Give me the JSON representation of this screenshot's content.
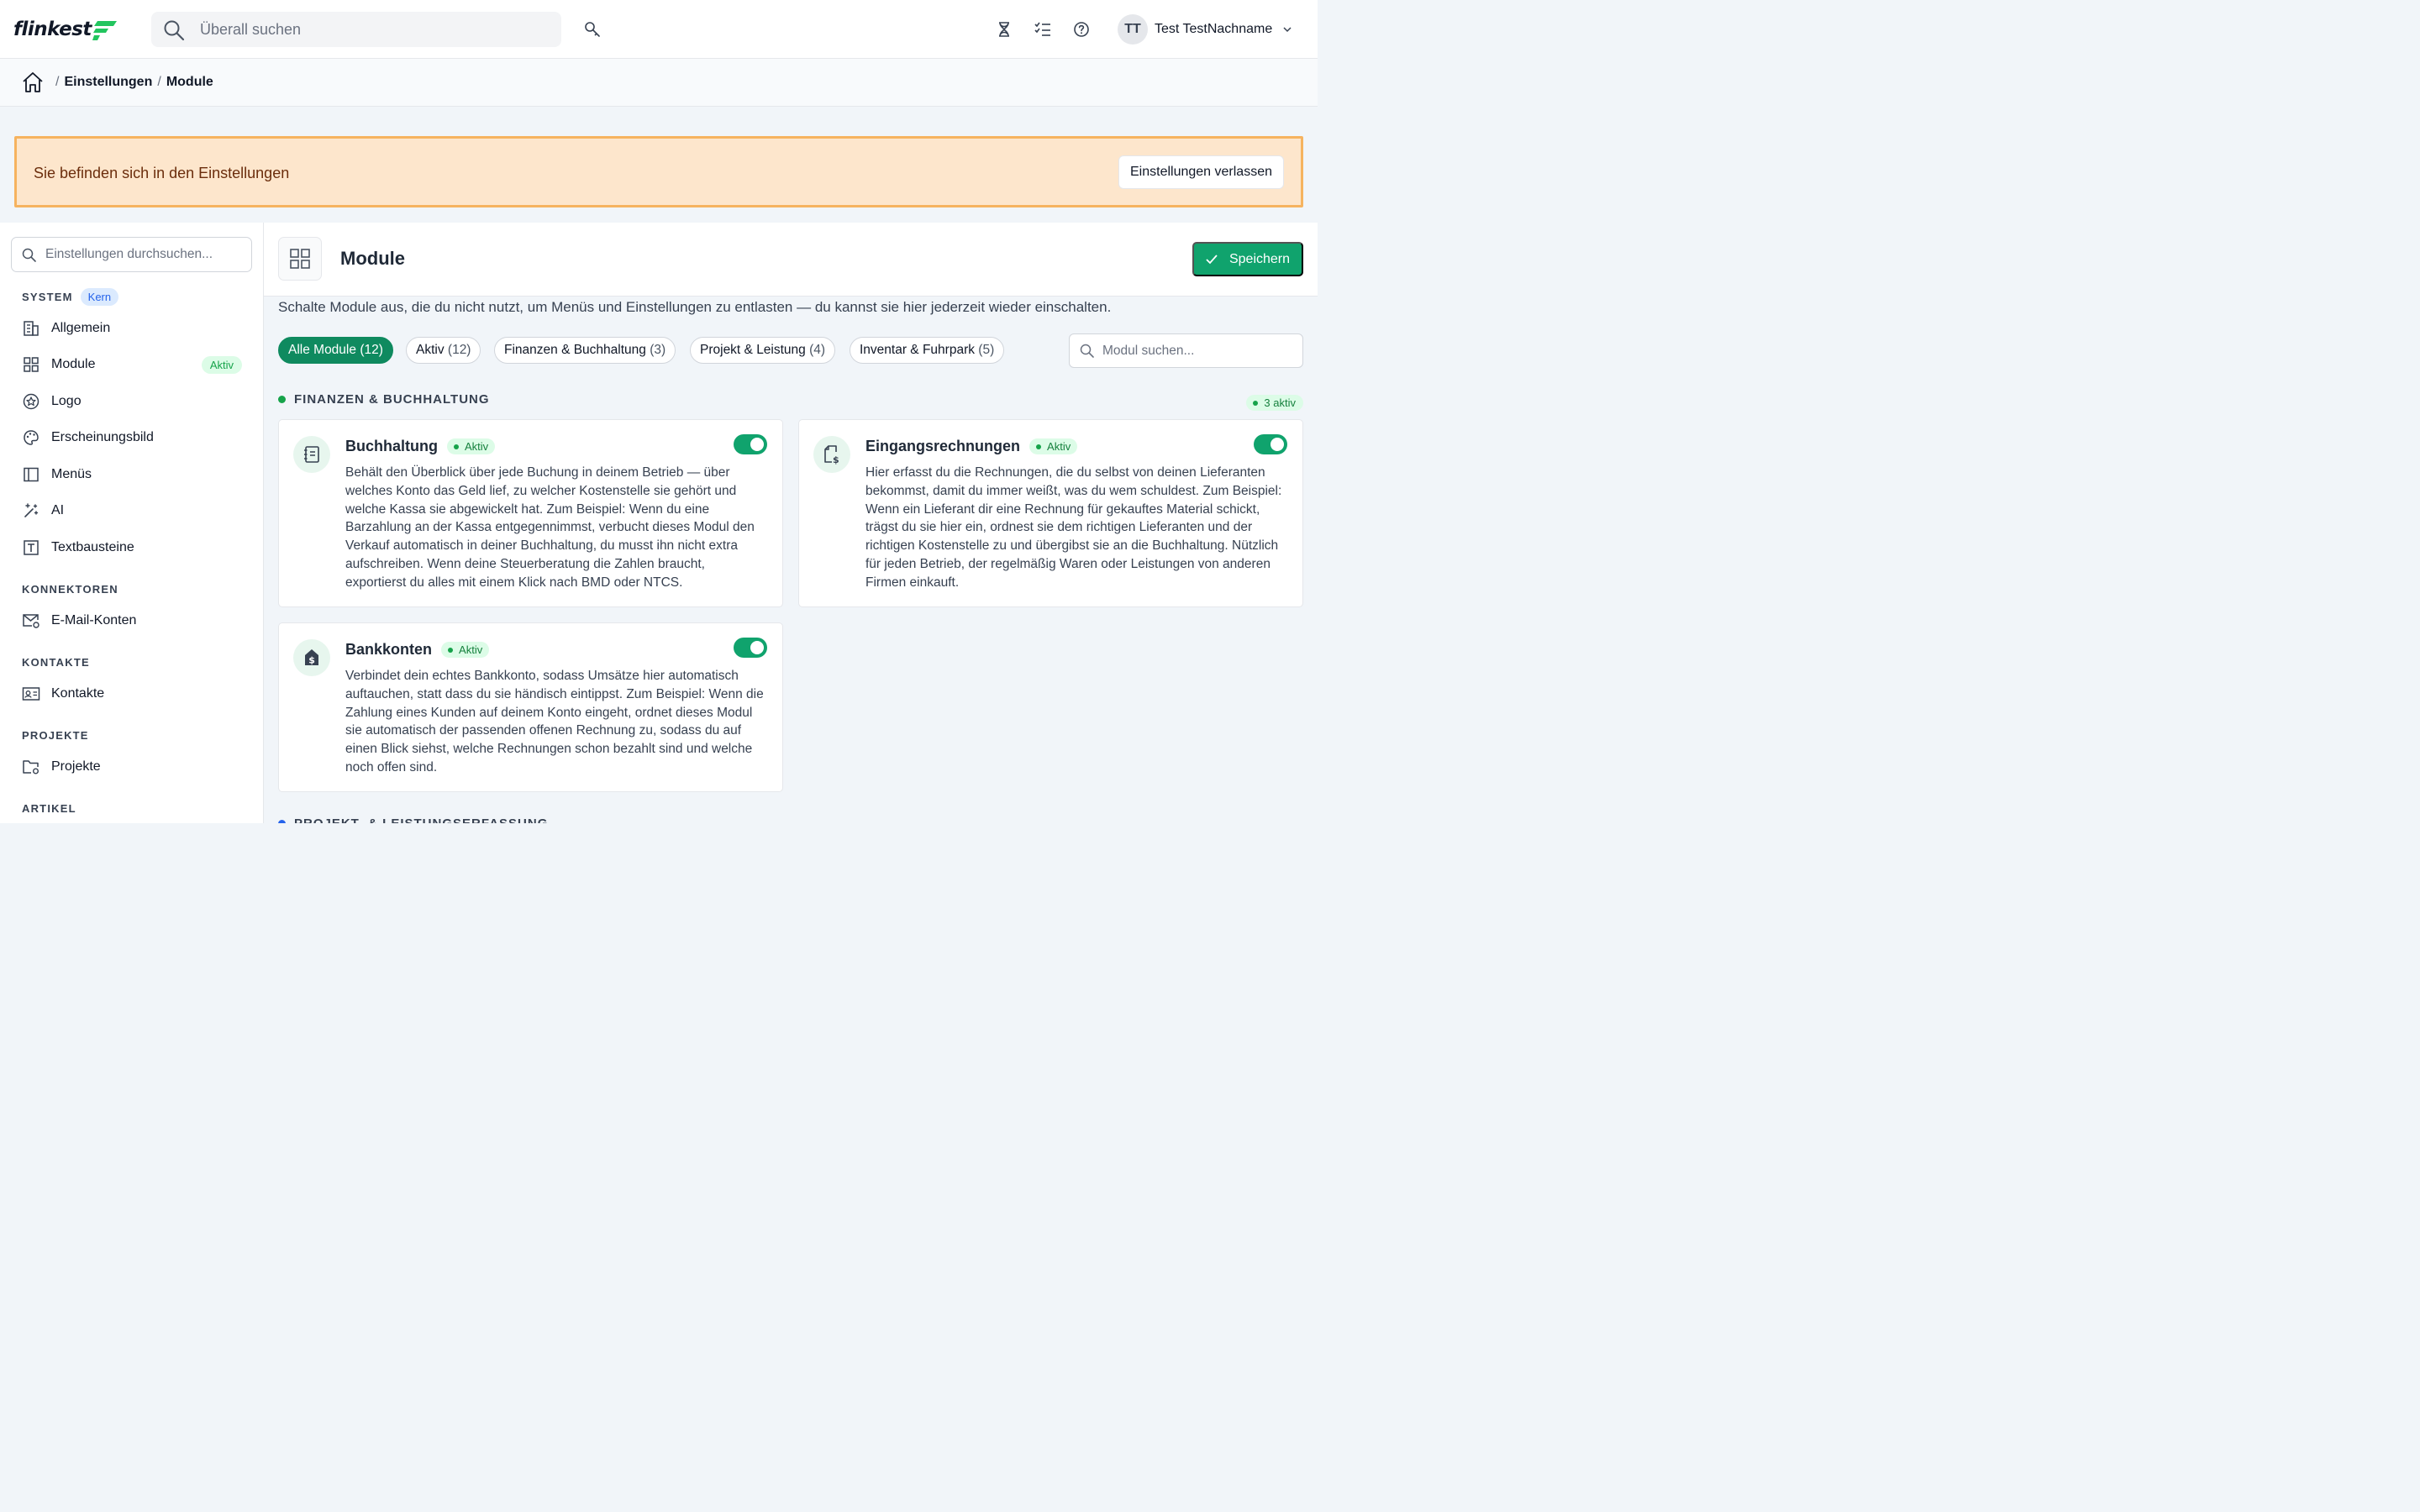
{
  "app": {
    "logo_text": "flinkest"
  },
  "header": {
    "search_placeholder": "Überall suchen",
    "icons": [
      "search-icon",
      "key-icon",
      "hourglass-icon",
      "checklist-icon",
      "help-icon",
      "chevron-down-icon"
    ],
    "user": {
      "initials": "TT",
      "name": "Test TestNachname"
    }
  },
  "breadcrumb": {
    "items": [
      "Einstellungen",
      "Module"
    ],
    "separator": "/"
  },
  "banner": {
    "text": "Sie befinden sich in den Einstellungen",
    "button": "Einstellungen verlassen",
    "colors": {
      "bg": "#fde6cc",
      "border": "#f6b35f",
      "text": "#6b2d0c"
    }
  },
  "sidebar": {
    "search_placeholder": "Einstellungen durchsuchen...",
    "sections": [
      {
        "title": "SYSTEM",
        "badge": "Kern",
        "items": [
          {
            "label": "Allgemein",
            "icon": "building-icon"
          },
          {
            "label": "Module",
            "icon": "grid-icon",
            "badge": "Aktiv"
          },
          {
            "label": "Logo",
            "icon": "star-badge-icon"
          },
          {
            "label": "Erscheinungsbild",
            "icon": "palette-icon"
          },
          {
            "label": "Menüs",
            "icon": "sidebar-layout-icon"
          },
          {
            "label": "AI",
            "icon": "magic-wand-icon"
          },
          {
            "label": "Textbausteine",
            "icon": "text-block-icon"
          }
        ]
      },
      {
        "title": "KONNEKTOREN",
        "items": [
          {
            "label": "E-Mail-Konten",
            "icon": "mail-settings-icon"
          }
        ]
      },
      {
        "title": "KONTAKTE",
        "items": [
          {
            "label": "Kontakte",
            "icon": "contact-card-icon"
          }
        ]
      },
      {
        "title": "PROJEKTE",
        "items": [
          {
            "label": "Projekte",
            "icon": "folder-settings-icon"
          }
        ]
      },
      {
        "title": "ARTIKEL",
        "items": []
      }
    ]
  },
  "main": {
    "title": "Module",
    "save_label": "Speichern",
    "description": "Schalte Module aus, die du nicht nutzt, um Menüs und Einstellungen zu entlasten — du kannst sie hier jederzeit wieder einschalten.",
    "filters": [
      {
        "label": "Alle Module",
        "count": "(12)",
        "active": true
      },
      {
        "label": "Aktiv",
        "count": "(12)"
      },
      {
        "label": "Finanzen & Buchhaltung",
        "count": "(3)"
      },
      {
        "label": "Projekt & Leistung",
        "count": "(4)"
      },
      {
        "label": "Inventar & Fuhrpark",
        "count": "(5)"
      }
    ],
    "module_search_placeholder": "Modul suchen...",
    "groups": [
      {
        "title": "FINANZEN & BUCHHALTUNG",
        "count_label": "3 aktiv",
        "modules": [
          {
            "name": "Buchhaltung",
            "status": "Aktiv",
            "enabled": true,
            "icon": "ledger-icon",
            "description": "Behält den Überblick über jede Buchung in deinem Betrieb — über welches Konto das Geld lief, zu welcher Kostenstelle sie gehört und welche Kassa sie abgewickelt hat. Zum Beispiel: Wenn du eine Barzahlung an der Kassa entgegennimmst, verbucht dieses Modul den Verkauf automatisch in deiner Buchhaltung, du musst ihn nicht extra aufschreiben. Wenn deine Steuerberatung die Zahlen braucht, exportierst du alles mit einem Klick nach BMD oder NTCS."
          },
          {
            "name": "Eingangsrechnungen",
            "status": "Aktiv",
            "enabled": true,
            "icon": "invoice-dollar-icon",
            "description": "Hier erfasst du die Rechnungen, die du selbst von deinen Lieferanten bekommst, damit du immer weißt, was du wem schuldest. Zum Beispiel: Wenn ein Lieferant dir eine Rechnung für gekauftes Material schickt, trägst du sie hier ein, ordnest sie dem richtigen Lieferanten und der richtigen Kostenstelle zu und übergibst sie an die Buchhaltung. Nützlich für jeden Betrieb, der regelmäßig Waren oder Leistungen von anderen Firmen einkauft."
          },
          {
            "name": "Bankkonten",
            "status": "Aktiv",
            "enabled": true,
            "icon": "bank-dollar-icon",
            "description": "Verbindet dein echtes Bankkonto, sodass Umsätze hier automatisch auftauchen, statt dass du sie händisch eintippst. Zum Beispiel: Wenn die Zahlung eines Kunden auf deinem Konto eingeht, ordnet dieses Modul sie automatisch der passenden offenen Rechnung zu, sodass du auf einen Blick siehst, welche Rechnungen schon bezahlt sind und welche noch offen sind."
          }
        ]
      }
    ],
    "next_group_peek": "PROJEKT- & LEISTUNGSERFASSUNG"
  },
  "colors": {
    "accent": "#10a36d",
    "active_chip": "#0f8a5f",
    "status_green": "#16a34a",
    "badge_blue": "#2563eb"
  }
}
